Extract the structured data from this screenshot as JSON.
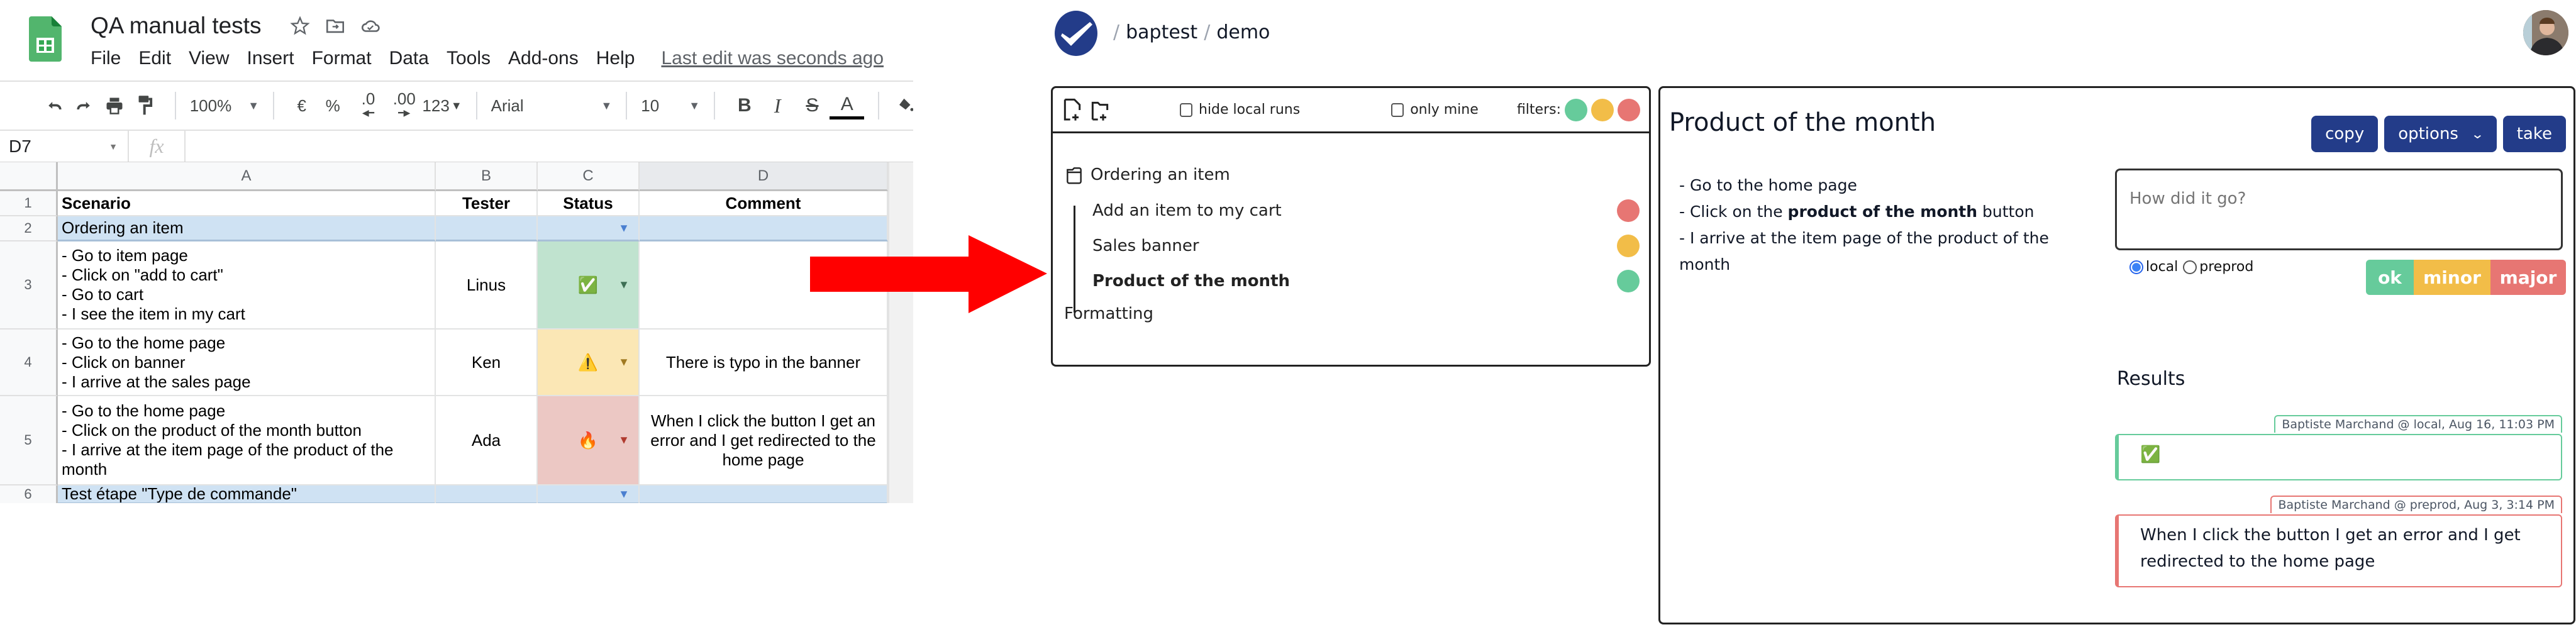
{
  "sheets": {
    "title": "QA manual tests",
    "title_icons": [
      "star-icon",
      "move-to-folder-icon",
      "cloud-saved-icon"
    ],
    "menu": [
      "File",
      "Edit",
      "View",
      "Insert",
      "Format",
      "Data",
      "Tools",
      "Add-ons",
      "Help"
    ],
    "last_edit": "Last edit was seconds ago",
    "toolbar": {
      "zoom": "100%",
      "currency": "€",
      "percent": "%",
      "decrease_decimal": ".0",
      "increase_decimal": ".00",
      "more_formats": "123",
      "font": "Arial",
      "font_size": "10",
      "bold": "B",
      "italic": "I",
      "strikethrough": "S",
      "text_color": "A"
    },
    "namebox": "D7",
    "fx": "fx",
    "columns": [
      "A",
      "B",
      "C",
      "D"
    ],
    "selected_column": "D",
    "rows": [
      {
        "num": "1",
        "scenario": "Scenario",
        "tester": "Tester",
        "status": "Status",
        "comment": "Comment",
        "kind": "header"
      },
      {
        "num": "2",
        "scenario": "Ordering an item",
        "tester": "",
        "status": "",
        "comment": "",
        "kind": "group"
      },
      {
        "num": "3",
        "scenario": "- Go to item page\n- Click on \"add to cart\"\n- Go to cart\n- I see the item in my cart",
        "tester": "Linus",
        "status": "✅",
        "comment": "",
        "kind": "ok"
      },
      {
        "num": "4",
        "scenario": "- Go to the home page\n- Click on banner\n- I arrive at the sales page",
        "tester": "Ken",
        "status": "⚠️",
        "comment": "There is typo in the banner",
        "kind": "minor"
      },
      {
        "num": "5",
        "scenario": "- Go to the home page\n- Click on the product of the month button\n- I arrive at the item page of the product of the month",
        "tester": "Ada",
        "status": "🔥",
        "comment": "When I click the button I get an error and I get redirected to the home page",
        "kind": "major"
      },
      {
        "num": "6",
        "scenario": "Test étape \"Type de commande\"",
        "tester": "",
        "status": "",
        "comment": "",
        "kind": "group"
      }
    ]
  },
  "app": {
    "breadcrumb": [
      "baptest",
      "demo"
    ],
    "left_panel": {
      "new_file_icon": "file-plus-icon",
      "new_folder_icon": "folder-plus-icon",
      "hide_local_runs": "hide local runs",
      "hide_local_runs_checked": false,
      "only_mine": "only mine",
      "only_mine_checked": false,
      "filters_label": "filters:",
      "folder": "Ordering an item",
      "tests": [
        {
          "name": "Add an item to my cart",
          "status": "major",
          "active": false
        },
        {
          "name": "Sales banner",
          "status": "minor",
          "active": false
        },
        {
          "name": "Product of the month",
          "status": "ok",
          "active": true
        }
      ],
      "other": "Formatting"
    },
    "detail": {
      "title": "Product of the month",
      "steps": [
        {
          "pre": "- Go to the home page",
          "bold": "",
          "post": ""
        },
        {
          "pre": "- Click on the ",
          "bold": "product of the month",
          "post": " button"
        },
        {
          "pre": "- I arrive at the item page of the product of the month",
          "bold": "",
          "post": ""
        }
      ],
      "buttons": {
        "copy": "copy",
        "options": "options",
        "take": "take"
      },
      "feedback_placeholder": "How did it go?",
      "env_options": [
        "local",
        "preprod"
      ],
      "env_selected": "local",
      "severity": {
        "ok": "ok",
        "minor": "minor",
        "major": "major"
      },
      "results_title": "Results",
      "results": [
        {
          "meta": "Baptiste Marchand @ local, Aug 16, 11:03 PM",
          "text": "✅",
          "status": "ok"
        },
        {
          "meta": "Baptiste Marchand @ preprod, Aug 3, 3:14 PM",
          "text": "When I click the button I get an error and I get redirected to the home page",
          "status": "major"
        }
      ]
    },
    "colors": {
      "ok": "#66cb9b",
      "minor": "#f2bd48",
      "major": "#e77673",
      "primary": "#233c89",
      "arrow": "#ff0000"
    }
  }
}
